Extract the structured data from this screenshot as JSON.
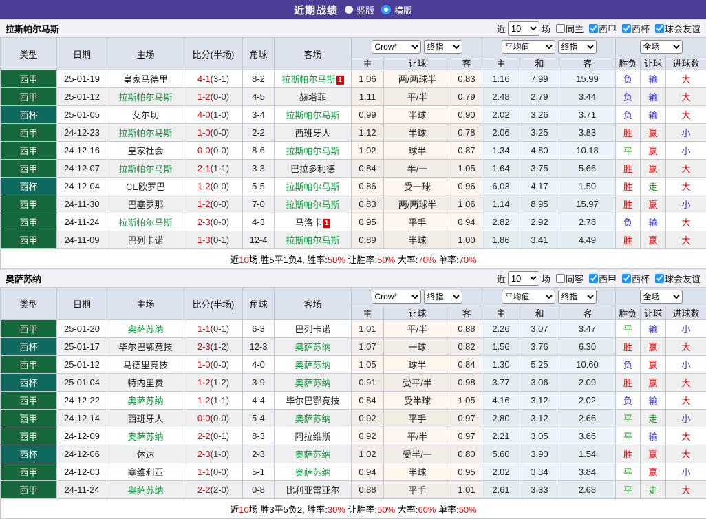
{
  "topbar": {
    "title": "近期战绩",
    "vertical_label": "竖版",
    "horizontal_label": "横版",
    "vertical_checked": false,
    "horizontal_checked": true
  },
  "colors": {
    "accent_purple": "#4c3d96",
    "laliga_green": "#15693a",
    "copa_teal": "#0e6a5f",
    "self_team_green": "#009933",
    "score_red": "#e60000",
    "win_red": "#e60000",
    "draw_green": "#18871b",
    "lose_blue": "#2b2bd5"
  },
  "filter_labels": {
    "near": "近",
    "matches": "场"
  },
  "dropdowns": {
    "count": "10",
    "bookmaker": "Crow*",
    "bookmaker_final": "终指",
    "average": "平均值",
    "average_final": "终指",
    "scope": "全场"
  },
  "header_labels": {
    "type": "类型",
    "date": "日期",
    "home": "主场",
    "score": "比分(半场)",
    "corner": "角球",
    "away": "客场",
    "odds_home": "主",
    "handicap": "让球",
    "odds_away": "客",
    "avg_home": "主",
    "avg_draw": "和",
    "avg_away": "客",
    "result": "胜负",
    "handicap_result": "让球",
    "goals": "进球数"
  },
  "sections": [
    {
      "team": "拉斯帕尔马斯",
      "checkboxes": [
        {
          "label": "同主",
          "checked": false
        },
        {
          "label": "西甲",
          "checked": true
        },
        {
          "label": "西杯",
          "checked": true
        },
        {
          "label": "球会友谊",
          "checked": true
        }
      ],
      "rows": [
        {
          "type": "西甲",
          "date": "25-01-19",
          "home": "皇家马德里",
          "home_rc": 0,
          "score": "4-1",
          "half": "(3-1)",
          "corner": "8-2",
          "away": "拉斯帕尔马斯",
          "away_rc": 1,
          "o1": "1.06",
          "hc": "两/两球半",
          "o2": "0.83",
          "a1": "1.16",
          "a2": "7.99",
          "a3": "15.99",
          "r1": "负",
          "r2": "输",
          "r3": "大"
        },
        {
          "type": "西甲",
          "date": "25-01-12",
          "home": "拉斯帕尔马斯",
          "home_rc": 0,
          "score": "1-2",
          "half": "(0-0)",
          "corner": "4-5",
          "away": "赫塔菲",
          "away_rc": 0,
          "o1": "1.11",
          "hc": "平/半",
          "o2": "0.79",
          "a1": "2.48",
          "a2": "2.79",
          "a3": "3.44",
          "r1": "负",
          "r2": "输",
          "r3": "大"
        },
        {
          "type": "西杯",
          "date": "25-01-05",
          "home": "艾尔切",
          "home_rc": 0,
          "score": "4-0",
          "half": "(1-0)",
          "corner": "3-4",
          "away": "拉斯帕尔马斯",
          "away_rc": 0,
          "o1": "0.99",
          "hc": "半球",
          "o2": "0.90",
          "a1": "2.02",
          "a2": "3.26",
          "a3": "3.71",
          "r1": "负",
          "r2": "输",
          "r3": "大"
        },
        {
          "type": "西甲",
          "date": "24-12-23",
          "home": "拉斯帕尔马斯",
          "home_rc": 0,
          "score": "1-0",
          "half": "(0-0)",
          "corner": "2-2",
          "away": "西班牙人",
          "away_rc": 0,
          "o1": "1.12",
          "hc": "半球",
          "o2": "0.78",
          "a1": "2.06",
          "a2": "3.25",
          "a3": "3.83",
          "r1": "胜",
          "r2": "赢",
          "r3": "小"
        },
        {
          "type": "西甲",
          "date": "24-12-16",
          "home": "皇家社会",
          "home_rc": 0,
          "score": "0-0",
          "half": "(0-0)",
          "corner": "8-6",
          "away": "拉斯帕尔马斯",
          "away_rc": 0,
          "o1": "1.02",
          "hc": "球半",
          "o2": "0.87",
          "a1": "1.34",
          "a2": "4.80",
          "a3": "10.18",
          "r1": "平",
          "r2": "赢",
          "r3": "小"
        },
        {
          "type": "西甲",
          "date": "24-12-07",
          "home": "拉斯帕尔马斯",
          "home_rc": 0,
          "score": "2-1",
          "half": "(1-1)",
          "corner": "3-3",
          "away": "巴拉多利德",
          "away_rc": 0,
          "o1": "0.84",
          "hc": "半/一",
          "o2": "1.05",
          "a1": "1.64",
          "a2": "3.75",
          "a3": "5.66",
          "r1": "胜",
          "r2": "赢",
          "r3": "大"
        },
        {
          "type": "西杯",
          "date": "24-12-04",
          "home": "CE欧罗巴",
          "home_rc": 0,
          "score": "1-2",
          "half": "(0-0)",
          "corner": "5-5",
          "away": "拉斯帕尔马斯",
          "away_rc": 0,
          "o1": "0.86",
          "hc": "受一球",
          "o2": "0.96",
          "a1": "6.03",
          "a2": "4.17",
          "a3": "1.50",
          "r1": "胜",
          "r2": "走",
          "r3": "大"
        },
        {
          "type": "西甲",
          "date": "24-11-30",
          "home": "巴塞罗那",
          "home_rc": 0,
          "score": "1-2",
          "half": "(0-0)",
          "corner": "7-0",
          "away": "拉斯帕尔马斯",
          "away_rc": 0,
          "o1": "0.83",
          "hc": "两/两球半",
          "o2": "1.06",
          "a1": "1.14",
          "a2": "8.95",
          "a3": "15.97",
          "r1": "胜",
          "r2": "赢",
          "r3": "小"
        },
        {
          "type": "西甲",
          "date": "24-11-24",
          "home": "拉斯帕尔马斯",
          "home_rc": 0,
          "score": "2-3",
          "half": "(0-0)",
          "corner": "4-3",
          "away": "马洛卡",
          "away_rc": 1,
          "o1": "0.95",
          "hc": "平手",
          "o2": "0.94",
          "a1": "2.82",
          "a2": "2.92",
          "a3": "2.78",
          "r1": "负",
          "r2": "输",
          "r3": "大"
        },
        {
          "type": "西甲",
          "date": "24-11-09",
          "home": "巴列卡诺",
          "home_rc": 0,
          "score": "1-3",
          "half": "(0-1)",
          "corner": "12-4",
          "away": "拉斯帕尔马斯",
          "away_rc": 0,
          "o1": "0.89",
          "hc": "半球",
          "o2": "1.00",
          "a1": "1.86",
          "a2": "3.41",
          "a3": "4.49",
          "r1": "胜",
          "r2": "赢",
          "r3": "大"
        }
      ],
      "summary": [
        {
          "t": "近"
        },
        {
          "t": "10",
          "r": true
        },
        {
          "t": "场,胜5平1负4, 胜率:"
        },
        {
          "t": "50%",
          "r": true
        },
        {
          "t": " 让胜率:"
        },
        {
          "t": "50%",
          "r": true
        },
        {
          "t": " 大率:"
        },
        {
          "t": "70%",
          "r": true
        },
        {
          "t": " 单率:"
        },
        {
          "t": "70%",
          "r": true
        }
      ]
    },
    {
      "team": "奥萨苏纳",
      "checkboxes": [
        {
          "label": "同客",
          "checked": false
        },
        {
          "label": "西甲",
          "checked": true
        },
        {
          "label": "西杯",
          "checked": true
        },
        {
          "label": "球会友谊",
          "checked": true
        }
      ],
      "rows": [
        {
          "type": "西甲",
          "date": "25-01-20",
          "home": "奥萨苏纳",
          "home_rc": 0,
          "score": "1-1",
          "half": "(0-1)",
          "corner": "6-3",
          "away": "巴列卡诺",
          "away_rc": 0,
          "o1": "1.01",
          "hc": "平/半",
          "o2": "0.88",
          "a1": "2.26",
          "a2": "3.07",
          "a3": "3.47",
          "r1": "平",
          "r2": "输",
          "r3": "小"
        },
        {
          "type": "西杯",
          "date": "25-01-17",
          "home": "毕尔巴鄂竞技",
          "home_rc": 0,
          "score": "2-3",
          "half": "(1-2)",
          "corner": "12-3",
          "away": "奥萨苏纳",
          "away_rc": 0,
          "o1": "1.07",
          "hc": "一球",
          "o2": "0.82",
          "a1": "1.56",
          "a2": "3.76",
          "a3": "6.30",
          "r1": "胜",
          "r2": "赢",
          "r3": "大"
        },
        {
          "type": "西甲",
          "date": "25-01-12",
          "home": "马德里竞技",
          "home_rc": 0,
          "score": "1-0",
          "half": "(0-0)",
          "corner": "4-0",
          "away": "奥萨苏纳",
          "away_rc": 0,
          "o1": "1.05",
          "hc": "球半",
          "o2": "0.84",
          "a1": "1.30",
          "a2": "5.25",
          "a3": "10.60",
          "r1": "负",
          "r2": "赢",
          "r3": "小"
        },
        {
          "type": "西杯",
          "date": "25-01-04",
          "home": "特内里费",
          "home_rc": 0,
          "score": "1-2",
          "half": "(1-2)",
          "corner": "3-9",
          "away": "奥萨苏纳",
          "away_rc": 0,
          "o1": "0.91",
          "hc": "受平/半",
          "o2": "0.98",
          "a1": "3.77",
          "a2": "3.06",
          "a3": "2.09",
          "r1": "胜",
          "r2": "赢",
          "r3": "大"
        },
        {
          "type": "西甲",
          "date": "24-12-22",
          "home": "奥萨苏纳",
          "home_rc": 0,
          "score": "1-2",
          "half": "(1-1)",
          "corner": "4-4",
          "away": "毕尔巴鄂竞技",
          "away_rc": 0,
          "o1": "0.84",
          "hc": "受半球",
          "o2": "1.05",
          "a1": "4.16",
          "a2": "3.12",
          "a3": "2.02",
          "r1": "负",
          "r2": "输",
          "r3": "大"
        },
        {
          "type": "西甲",
          "date": "24-12-14",
          "home": "西班牙人",
          "home_rc": 0,
          "score": "0-0",
          "half": "(0-0)",
          "corner": "5-4",
          "away": "奥萨苏纳",
          "away_rc": 0,
          "o1": "0.92",
          "hc": "平手",
          "o2": "0.97",
          "a1": "2.80",
          "a2": "3.12",
          "a3": "2.66",
          "r1": "平",
          "r2": "走",
          "r3": "小"
        },
        {
          "type": "西甲",
          "date": "24-12-09",
          "home": "奥萨苏纳",
          "home_rc": 0,
          "score": "2-2",
          "half": "(0-1)",
          "corner": "8-3",
          "away": "阿拉维斯",
          "away_rc": 0,
          "o1": "0.92",
          "hc": "平/半",
          "o2": "0.97",
          "a1": "2.21",
          "a2": "3.05",
          "a3": "3.66",
          "r1": "平",
          "r2": "输",
          "r3": "大"
        },
        {
          "type": "西杯",
          "date": "24-12-06",
          "home": "休达",
          "home_rc": 0,
          "score": "2-3",
          "half": "(1-0)",
          "corner": "2-3",
          "away": "奥萨苏纳",
          "away_rc": 0,
          "o1": "1.02",
          "hc": "受半/一",
          "o2": "0.80",
          "a1": "5.60",
          "a2": "3.90",
          "a3": "1.54",
          "r1": "胜",
          "r2": "赢",
          "r3": "大"
        },
        {
          "type": "西甲",
          "date": "24-12-03",
          "home": "塞维利亚",
          "home_rc": 0,
          "score": "1-1",
          "half": "(0-0)",
          "corner": "5-1",
          "away": "奥萨苏纳",
          "away_rc": 0,
          "o1": "0.94",
          "hc": "半球",
          "o2": "0.95",
          "a1": "2.02",
          "a2": "3.34",
          "a3": "3.84",
          "r1": "平",
          "r2": "赢",
          "r3": "小"
        },
        {
          "type": "西甲",
          "date": "24-11-24",
          "home": "奥萨苏纳",
          "home_rc": 0,
          "score": "2-2",
          "half": "(2-0)",
          "corner": "0-8",
          "away": "比利亚雷亚尔",
          "away_rc": 0,
          "o1": "0.88",
          "hc": "平手",
          "o2": "1.01",
          "a1": "2.61",
          "a2": "3.33",
          "a3": "2.68",
          "r1": "平",
          "r2": "走",
          "r3": "大"
        }
      ],
      "summary": [
        {
          "t": "近"
        },
        {
          "t": "10",
          "r": true
        },
        {
          "t": "场,胜3平5负2, 胜率:"
        },
        {
          "t": "30%",
          "r": true
        },
        {
          "t": " 让胜率:"
        },
        {
          "t": "50%",
          "r": true
        },
        {
          "t": " 大率:"
        },
        {
          "t": "60%",
          "r": true
        },
        {
          "t": " 单率:"
        },
        {
          "t": "50%",
          "r": true
        }
      ]
    }
  ]
}
